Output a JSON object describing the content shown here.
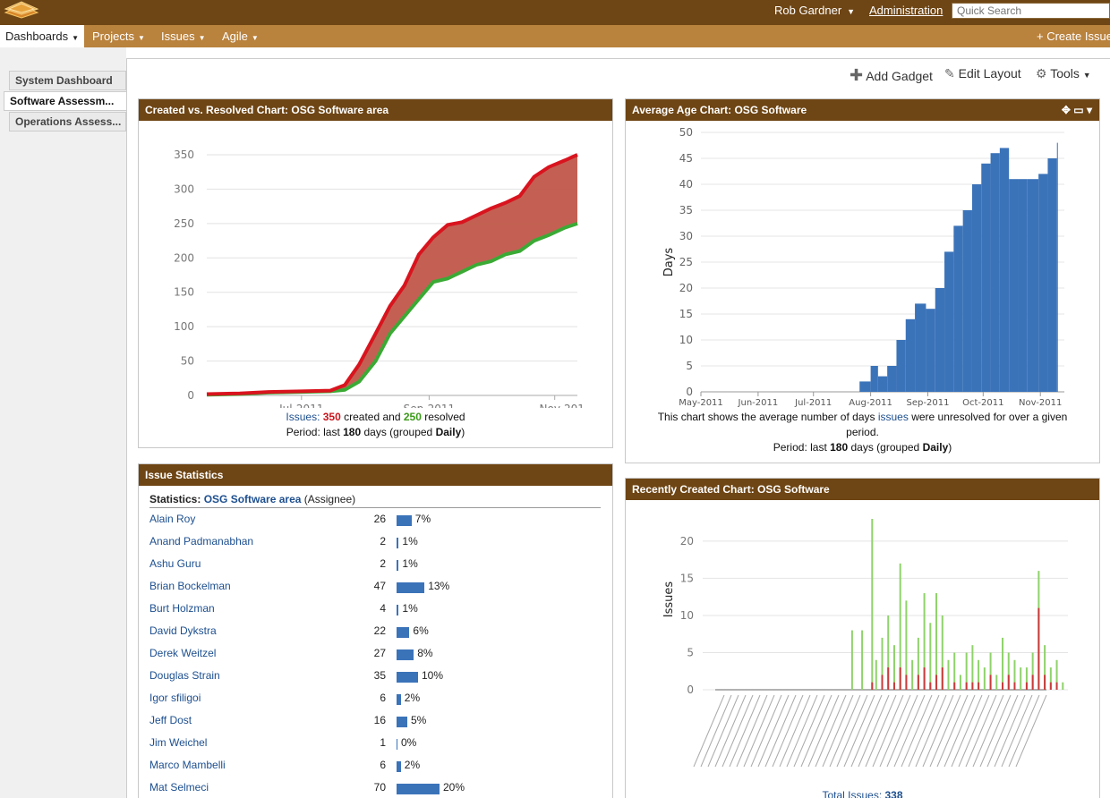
{
  "header": {
    "user_name": "Rob Gardner",
    "admin_label": "Administration",
    "search_placeholder": "Quick Search",
    "nav": [
      {
        "label": "Dashboards"
      },
      {
        "label": "Projects"
      },
      {
        "label": "Issues"
      },
      {
        "label": "Agile"
      }
    ],
    "create_label": "Create Issue"
  },
  "sidebar": {
    "tabs": [
      {
        "label": "System Dashboard"
      },
      {
        "label": "Software Assessm..."
      },
      {
        "label": "Operations Assess..."
      }
    ]
  },
  "toolbar": {
    "add_gadget": "Add Gadget",
    "edit_layout": "Edit Layout",
    "tools": "Tools"
  },
  "colors": {
    "header_bg": "#6e4514",
    "nav_bg": "#b9823d",
    "created": "#d9141e",
    "resolved": "#3aaa35",
    "area_fill": "#c0574a",
    "bar_blue": "#3b73b9"
  },
  "gadgets": {
    "created_resolved": {
      "title": "Created vs. Resolved Chart: OSG Software area",
      "caption": {
        "issues_label": "Issues:",
        "created_count": "350",
        "created_text": "created and",
        "resolved_count": "250",
        "resolved_text": "resolved",
        "period_prefix": "Period: last",
        "period_days": "180",
        "period_mid": "days (grouped",
        "period_group": "Daily",
        "period_suffix": ")"
      }
    },
    "average_age": {
      "title": "Average Age Chart: OSG Software",
      "caption": {
        "line1_prefix": "This chart shows the average number of days",
        "line1_link": "issues",
        "line1_suffix": "were unresolved for over a given",
        "line2": "period.",
        "period_prefix": "Period: last",
        "period_days": "180",
        "period_mid": "days (grouped",
        "period_group": "Daily",
        "period_suffix": ")"
      }
    },
    "issue_statistics": {
      "title": "Issue Statistics",
      "stats_label": "Statistics:",
      "stats_filter": "OSG Software area",
      "stats_type": "(Assignee)",
      "rows": [
        {
          "name": "Alain Roy",
          "count": "26",
          "pct": "7%",
          "share": 7
        },
        {
          "name": "Anand Padmanabhan",
          "count": "2",
          "pct": "1%",
          "share": 1
        },
        {
          "name": "Ashu Guru",
          "count": "2",
          "pct": "1%",
          "share": 1
        },
        {
          "name": "Brian Bockelman",
          "count": "47",
          "pct": "13%",
          "share": 13
        },
        {
          "name": "Burt Holzman",
          "count": "4",
          "pct": "1%",
          "share": 1
        },
        {
          "name": "David Dykstra",
          "count": "22",
          "pct": "6%",
          "share": 6
        },
        {
          "name": "Derek Weitzel",
          "count": "27",
          "pct": "8%",
          "share": 8
        },
        {
          "name": "Douglas Strain",
          "count": "35",
          "pct": "10%",
          "share": 10
        },
        {
          "name": "Igor sfiligoi",
          "count": "6",
          "pct": "2%",
          "share": 2
        },
        {
          "name": "Jeff Dost",
          "count": "16",
          "pct": "5%",
          "share": 5
        },
        {
          "name": "Jim Weichel",
          "count": "1",
          "pct": "0%",
          "share": 0
        },
        {
          "name": "Marco Mambelli",
          "count": "6",
          "pct": "2%",
          "share": 2
        },
        {
          "name": "Mat Selmeci",
          "count": "70",
          "pct": "20%",
          "share": 20
        }
      ]
    },
    "recently_created": {
      "title": "Recently Created Chart: OSG Software",
      "total_label": "Total Issues:",
      "total_value": "338"
    }
  },
  "chart_data": [
    {
      "type": "area",
      "title": "Created vs. Resolved Chart: OSG Software area",
      "xlabel": "",
      "ylabel": "",
      "ylim": [
        0,
        350
      ],
      "yticks": [
        "0",
        "50",
        "100",
        "150",
        "200",
        "250",
        "300",
        "350"
      ],
      "xticks": [
        "Jul-2011",
        "Sep-2011",
        "Nov-201"
      ],
      "x": [
        "2011-05-16",
        "2011-06-01",
        "2011-06-15",
        "2011-07-01",
        "2011-07-15",
        "2011-07-22",
        "2011-07-29",
        "2011-08-06",
        "2011-08-13",
        "2011-08-20",
        "2011-08-27",
        "2011-09-03",
        "2011-09-10",
        "2011-09-17",
        "2011-09-24",
        "2011-10-01",
        "2011-10-08",
        "2011-10-15",
        "2011-10-22",
        "2011-10-29",
        "2011-11-06",
        "2011-11-12"
      ],
      "series": [
        {
          "name": "created",
          "values": [
            2,
            3,
            5,
            6,
            7,
            15,
            45,
            90,
            130,
            160,
            205,
            230,
            248,
            252,
            262,
            272,
            280,
            290,
            318,
            332,
            342,
            350
          ]
        },
        {
          "name": "resolved",
          "values": [
            1,
            2,
            4,
            5,
            6,
            8,
            20,
            50,
            90,
            115,
            140,
            165,
            170,
            180,
            190,
            195,
            205,
            210,
            225,
            233,
            244,
            250
          ]
        }
      ]
    },
    {
      "type": "bar",
      "title": "Average Age Chart: OSG Software",
      "ylabel": "Days",
      "ylim": [
        0,
        50
      ],
      "yticks": [
        "0",
        "5",
        "10",
        "15",
        "20",
        "25",
        "30",
        "35",
        "40",
        "45",
        "50"
      ],
      "xticks": [
        "May-2011",
        "Jun-2011",
        "Jul-2011",
        "Aug-2011",
        "Sep-2011",
        "Oct-2011",
        "Nov-2011"
      ],
      "x": [
        "2011-07-26",
        "2011-08-01",
        "2011-08-05",
        "2011-08-10",
        "2011-08-15",
        "2011-08-20",
        "2011-08-25",
        "2011-08-31",
        "2011-09-05",
        "2011-09-10",
        "2011-09-15",
        "2011-09-20",
        "2011-09-25",
        "2011-09-30",
        "2011-10-05",
        "2011-10-10",
        "2011-10-15",
        "2011-10-20",
        "2011-10-25",
        "2011-10-31",
        "2011-11-05",
        "2011-11-10"
      ],
      "values": [
        2,
        5,
        3,
        5,
        10,
        14,
        17,
        16,
        20,
        27,
        32,
        35,
        40,
        44,
        46,
        47,
        41,
        41,
        41,
        42,
        45,
        48
      ]
    },
    {
      "type": "bar",
      "title": "Recently Created Chart: OSG Software",
      "ylabel": "Issues",
      "ylim": [
        0,
        23
      ],
      "yticks": [
        "0",
        "5",
        "10",
        "15",
        "20"
      ],
      "categories": [
        "2011-07-29",
        "2011-08-03",
        "2011-08-08",
        "2011-08-10",
        "2011-08-13",
        "2011-08-16",
        "2011-08-19",
        "2011-08-22",
        "2011-08-25",
        "2011-08-28",
        "2011-08-31",
        "2011-09-03",
        "2011-09-06",
        "2011-09-09",
        "2011-09-12",
        "2011-09-15",
        "2011-09-18",
        "2011-09-21",
        "2011-09-24",
        "2011-09-27",
        "2011-09-30",
        "2011-10-03",
        "2011-10-06",
        "2011-10-09",
        "2011-10-12",
        "2011-10-15",
        "2011-10-18",
        "2011-10-21",
        "2011-10-24",
        "2011-10-27",
        "2011-10-30",
        "2011-11-02",
        "2011-11-05",
        "2011-11-08",
        "2011-11-11"
      ],
      "series": [
        {
          "name": "created",
          "values": [
            8,
            8,
            23,
            4,
            7,
            10,
            6,
            17,
            12,
            4,
            7,
            13,
            9,
            13,
            10,
            4,
            5,
            2,
            5,
            6,
            4,
            3,
            5,
            2,
            7,
            5,
            4,
            3,
            3,
            5,
            16,
            6,
            3,
            4,
            1
          ]
        },
        {
          "name": "resolved",
          "values": [
            0,
            0,
            1,
            0,
            2,
            3,
            1,
            3,
            2,
            0,
            2,
            3,
            1,
            2,
            3,
            0,
            1,
            0,
            1,
            1,
            1,
            0,
            2,
            0,
            1,
            2,
            1,
            0,
            1,
            2,
            11,
            2,
            1,
            1,
            0
          ]
        }
      ]
    }
  ]
}
